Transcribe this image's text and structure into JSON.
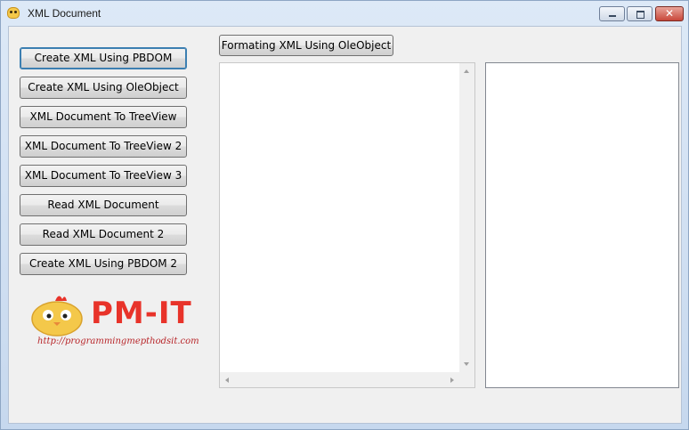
{
  "window": {
    "title": "XML Document",
    "close_glyph": "✕"
  },
  "buttons": {
    "left": [
      {
        "label": "Create XML Using PBDOM"
      },
      {
        "label": "Create XML Using OleObject"
      },
      {
        "label": "XML Document To TreeView"
      },
      {
        "label": "XML Document To TreeView 2"
      },
      {
        "label": "XML Document To TreeView 3"
      },
      {
        "label": "Read  XML Document"
      },
      {
        "label": "Read  XML Document 2"
      },
      {
        "label": "Create XML Using PBDOM 2"
      }
    ],
    "format": {
      "label": "Formating XML Using OleObject"
    }
  },
  "logo": {
    "brand": "PM-IT",
    "url": "http://programmingmepthodsit.com",
    "colors": {
      "brand": "#e8332a",
      "mascot": "#f4c84a"
    }
  },
  "panels": {
    "left_text": "",
    "right_text": ""
  }
}
